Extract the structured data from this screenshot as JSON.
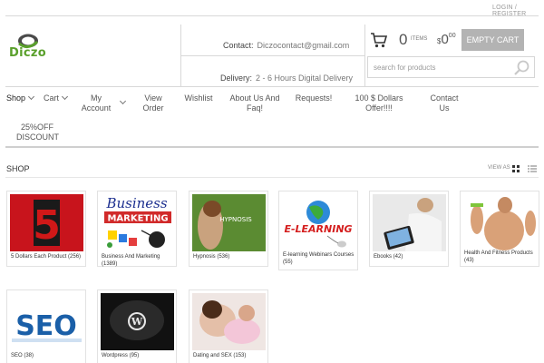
{
  "header": {
    "login_link": "LOGIN / REGISTER",
    "logo_text": "Diczo",
    "contact_label": "Contact:",
    "contact_value": "Diczocontact@gmail.com",
    "delivery_label": "Delivery:",
    "delivery_value": "2 - 6 Hours Digital Delivery",
    "cart_count": "0",
    "cart_items_label": "ITEMS",
    "cart_currency": "$",
    "cart_total_main": "0",
    "cart_total_cents": "00",
    "empty_cart_label": "EMPTY CART",
    "search_placeholder": "search for products"
  },
  "nav": {
    "items": [
      {
        "label": "Shop"
      },
      {
        "label": "Cart"
      },
      {
        "label": "My Account"
      },
      {
        "label": "View Order"
      },
      {
        "label": "Wishlist"
      },
      {
        "label": "About Us And Faq!"
      },
      {
        "label": "Requests!"
      },
      {
        "label": "100 $ Dollars Offer!!!!"
      },
      {
        "label": "Contact Us"
      },
      {
        "label": "25%OFF DISCOUNT"
      }
    ]
  },
  "shop": {
    "title": "SHOP",
    "view_as": "VIEW AS",
    "products": [
      {
        "label": "5 Dollars Each Product (256)"
      },
      {
        "label": "Business And Marketing (1389)"
      },
      {
        "label": "Hypnosis (536)"
      },
      {
        "label": "E-learning Webinars Courses (55)"
      },
      {
        "label": "Ebooks (42)"
      },
      {
        "label": "Health And Fitness Products (43)"
      },
      {
        "label": "SEO (38)"
      },
      {
        "label": "Wordpress (95)"
      },
      {
        "label": "Dating and SEX (153)"
      }
    ],
    "thumb_text": {
      "business_top": "Business",
      "business_mid": "MARKETING",
      "hypnosis": "HYPNOSIS",
      "elearning": "E-LEARNING",
      "seo": "SEO",
      "five": "5"
    }
  },
  "colors": {
    "logo_green": "#5aa02c",
    "button_grey": "#b3b3b3",
    "border": "#d8d8d8"
  }
}
